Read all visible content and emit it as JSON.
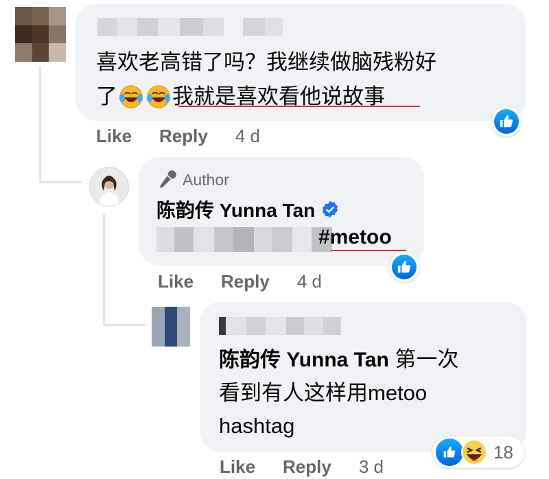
{
  "comments": [
    {
      "text_line1": "喜欢老高错了吗？我继续做脑残粉好",
      "text_line2_prefix": "了",
      "text_line2_suffix": "我就是喜欢看他说故事",
      "actions": {
        "like": "Like",
        "reply": "Reply",
        "time": "4 d"
      }
    },
    {
      "author_badge": "Author",
      "name": "陈韵传 Yunna Tan",
      "hashtag": "#metoo",
      "actions": {
        "like": "Like",
        "reply": "Reply",
        "time": "4 d"
      }
    },
    {
      "name_prefix": "陈韵传 Yunna Tan",
      "text_line1_suffix": " 第一次",
      "text_line2": "看到有人这样用metoo",
      "text_line3": "hashtag",
      "actions": {
        "like": "Like",
        "reply": "Reply",
        "time": "3 d"
      },
      "reaction_count": "18"
    }
  ],
  "colors": {
    "accent": "#1877f2",
    "bubble": "#f0f2f5",
    "meta": "#65676b",
    "underline": "#e02b2b"
  },
  "icons": [
    "like-icon",
    "haha-icon",
    "verified-icon",
    "microphone-icon",
    "laughing-crying-emoji"
  ]
}
